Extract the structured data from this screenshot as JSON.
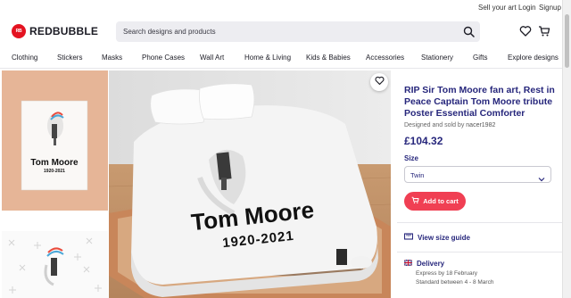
{
  "utility_links": [
    "Sell your art",
    "Login",
    "Signup"
  ],
  "brand": {
    "mark": "RB",
    "name": "REDBUBBLE"
  },
  "search": {
    "placeholder": "Search designs and products"
  },
  "nav": [
    "Clothing",
    "Stickers",
    "Masks",
    "Phone Cases",
    "Wall Art",
    "Home & Living",
    "Kids & Babies",
    "Accessories",
    "Stationery",
    "Gifts",
    "Explore designs"
  ],
  "thumbnail": {
    "artwork_title": "Tom Moore",
    "artwork_years": "1920-2021"
  },
  "product_image": {
    "artwork_title": "Tom Moore",
    "artwork_years": "1920-2021"
  },
  "product": {
    "title": "RIP Sir Tom Moore fan art, Rest in Peace Captain Tom Moore tribute Poster Essential Comforter",
    "seller_prefix": "Designed and sold by",
    "seller": "nacer1982",
    "price": "£104.32",
    "size_label": "Size",
    "size_value": "Twin",
    "cart_label": "Add to cart",
    "size_guide": "View size guide"
  },
  "delivery": {
    "heading": "Delivery",
    "express": "Express by 18 February",
    "standard": "Standard between 4 - 8 March"
  },
  "colors": {
    "brand": "#e41321",
    "cta": "#f03f53",
    "navy": "#27277c"
  },
  "icons": [
    "logo-mark",
    "search-icon",
    "heart-icon",
    "cart-icon",
    "ruler-icon",
    "uk-flag-icon",
    "chevron-down-icon"
  ]
}
